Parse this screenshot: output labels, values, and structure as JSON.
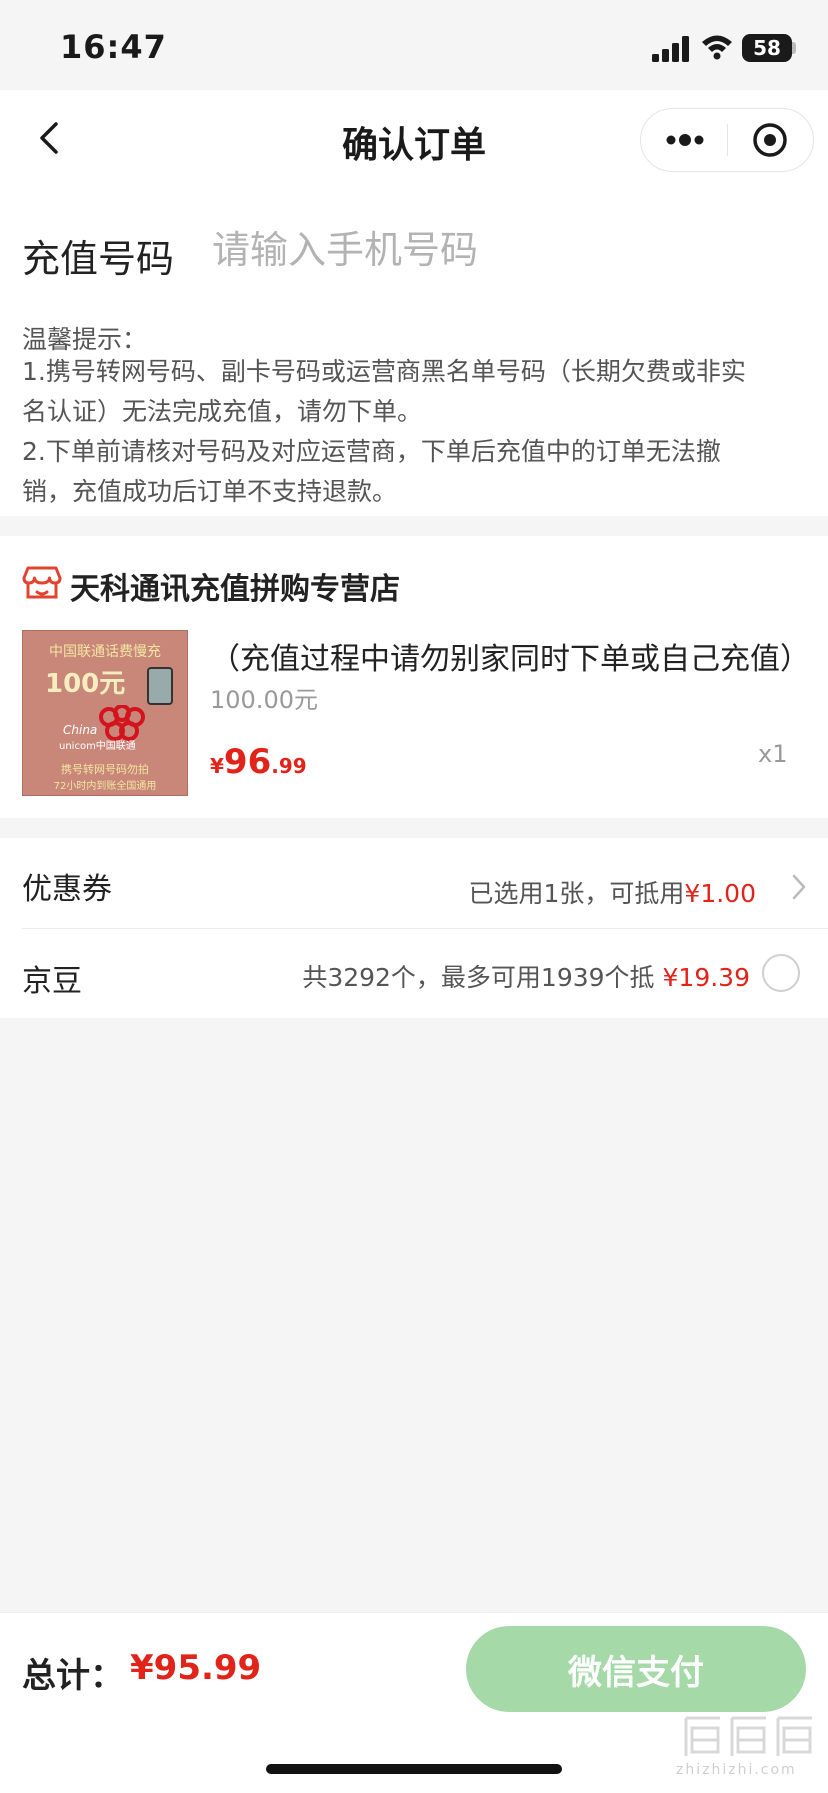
{
  "status_bar": {
    "time": "16:47",
    "battery": "58"
  },
  "nav": {
    "title": "确认订单"
  },
  "phone": {
    "label": "充值号码",
    "placeholder": "请输入手机号码"
  },
  "tips": {
    "title": "温馨提示：",
    "lines": [
      "1.携号转网号码、副卡号码或运营商黑名单号码（长期欠费或非实",
      "名认证）无法完成充值，请勿下单。",
      "2.下单前请核对号码及对应运营商，下单后充值中的订单无法撤",
      "销，充值成功后订单不支持退款。"
    ]
  },
  "shop": {
    "name": "天科通讯充值拼购专营店"
  },
  "product": {
    "image_text": {
      "top": "中国联通话费慢充",
      "amount": "100元",
      "brand_en": "China",
      "brand_en2": "unicom中国联通",
      "line1": "携号转网号码勿拍",
      "line2": "72小时内到账全国通用"
    },
    "title": "（充值过程中请勿别家同时下单或自己充值）",
    "spec": "100.00元",
    "price_symbol": "¥",
    "price_int": "96",
    "price_dec": ".99",
    "quantity": "x1"
  },
  "coupon": {
    "label": "优惠券",
    "text": "已选用1张，可抵用",
    "amount": "¥1.00"
  },
  "beans": {
    "label": "京豆",
    "text": "共3292个，最多可用1939个抵 ",
    "amount": "¥19.39",
    "selected": false
  },
  "footer": {
    "total_label": "总计：",
    "total": "¥95.99",
    "pay_button": "微信支付"
  },
  "watermark": {
    "text": "zhizhizhi.com"
  },
  "colors": {
    "accent_red": "#e2231a",
    "pay_green": "#a5d9a8"
  }
}
